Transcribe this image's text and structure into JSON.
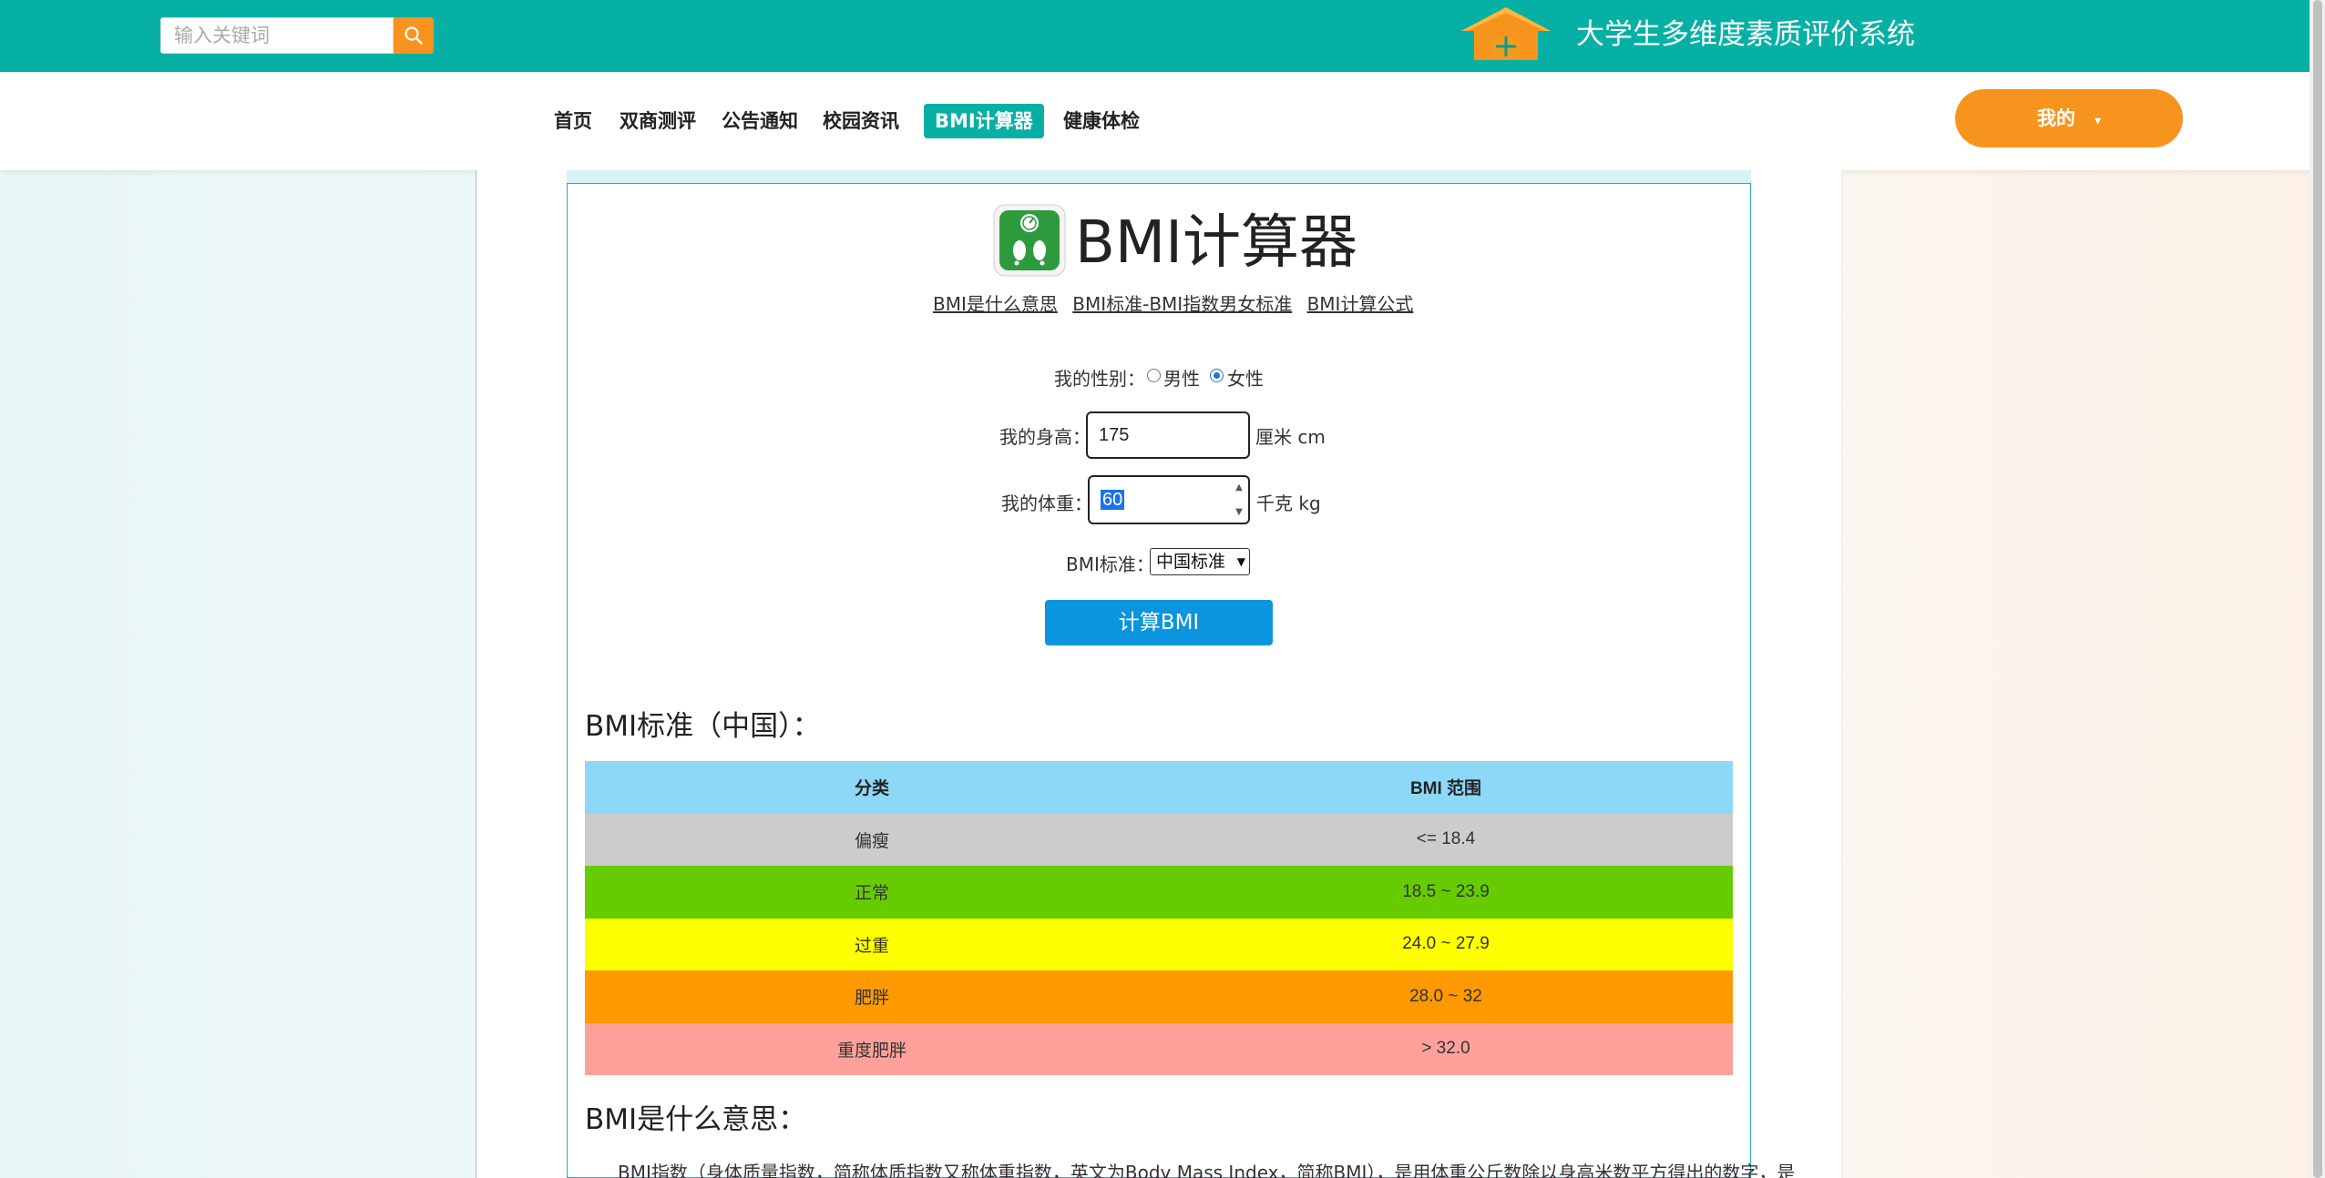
{
  "search": {
    "placeholder": "输入关键词"
  },
  "site": {
    "title": "大学生多维度素质评价系统"
  },
  "nav": {
    "items": [
      {
        "label": "首页"
      },
      {
        "label": "双商测评"
      },
      {
        "label": "公告通知"
      },
      {
        "label": "校园资讯"
      },
      {
        "label": "BMI计算器",
        "active": true
      },
      {
        "label": "健康体检"
      }
    ],
    "user_menu_label": "我的",
    "user_menu_caret": "▾"
  },
  "calculator": {
    "title": "BMI计算器",
    "links": [
      "BMI是什么意思",
      "BMI标准-BMI指数男女标准",
      "BMI计算公式"
    ],
    "gender_label": "我的性别：",
    "gender_options": [
      "男性",
      "女性"
    ],
    "gender_selected": "女性",
    "height_label": "我的身高：",
    "height_value": "175",
    "height_unit": "厘米 cm",
    "weight_label": "我的体重：",
    "weight_value": "60",
    "weight_unit": "千克 kg",
    "standard_label": "BMI标准：",
    "standard_selected": "中国标准",
    "calculate_button": "计算BMI"
  },
  "standard_section": {
    "heading": "BMI标准（中国）：",
    "table_headers": [
      "分类",
      "BMI 范围"
    ],
    "rows": [
      {
        "category": "偏瘦",
        "range": "<= 18.4",
        "color": "#cccccc"
      },
      {
        "category": "正常",
        "range": "18.5 ~ 23.9",
        "color": "#66cc00"
      },
      {
        "category": "过重",
        "range": "24.0 ~ 27.9",
        "color": "#ffff00"
      },
      {
        "category": "肥胖",
        "range": "28.0 ~ 32",
        "color": "#ff9900"
      },
      {
        "category": "重度肥胖",
        "range": "> 32.0",
        "color": "#ffa19b"
      }
    ],
    "header_color": "#8dd7f7"
  },
  "meaning_section": {
    "heading": "BMI是什么意思：",
    "paragraph": "BMI指数（身体质量指数，简称体质指数又称体重指数，英文为Body Mass Index，简称BMI），是用体重公斤数除以身高米数平方得出的数字，是"
  },
  "colors": {
    "brand": "#07b0a4",
    "accent": "#f7941d",
    "button": "#0b95de"
  }
}
